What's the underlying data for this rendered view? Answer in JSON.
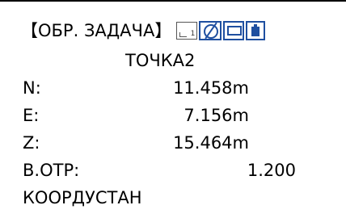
{
  "header": {
    "title": "【ОБР. ЗАДАЧА】",
    "status": {
      "prism_constant_indicator": "1",
      "icons": [
        "target-icon",
        "message-icon",
        "battery-icon"
      ],
      "accent_color": "#1f4fa0"
    }
  },
  "point": {
    "name": "ТОЧКА2"
  },
  "coords": {
    "n_label": "N:",
    "n_value": "11.458m",
    "e_label": "E:",
    "e_value": "7.156m",
    "z_label": "Z:",
    "z_value": "15.464m"
  },
  "height": {
    "label": "В.ОТР:",
    "value": "1.200"
  },
  "softkey": {
    "label": "КООРДУСТАН"
  }
}
